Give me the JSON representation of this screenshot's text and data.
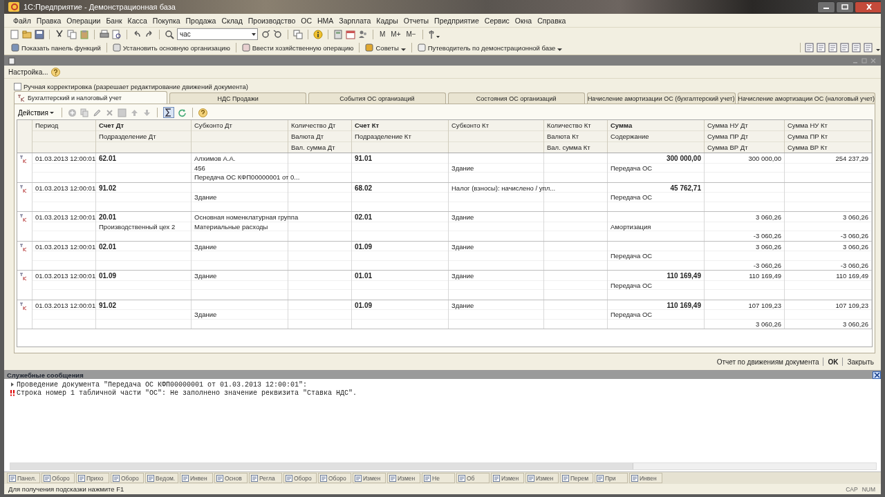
{
  "window": {
    "title": "1С:Предприятие - Демонстрационная база"
  },
  "menu": [
    "Файл",
    "Правка",
    "Операции",
    "Банк",
    "Касса",
    "Покупка",
    "Продажа",
    "Склад",
    "Производство",
    "ОС",
    "НМА",
    "Зарплата",
    "Кадры",
    "Отчеты",
    "Предприятие",
    "Сервис",
    "Окна",
    "Справка"
  ],
  "toolbar": {
    "search": {
      "value": "час"
    },
    "memory_buttons": [
      "M",
      "M+",
      "M−"
    ]
  },
  "toolbar_2": [
    "Показать панель функций",
    "Установить основную организацию",
    "Ввести хозяйственную операцию",
    "Советы",
    "Путеводитель по демонстрационной базе"
  ],
  "document": {
    "settings_link": "Настройка...",
    "manual_edit": {
      "label": "Ручная корректировка (разрешает редактирование движений документа)",
      "checked": false
    },
    "tabs": [
      {
        "label": "Бухгалтерский и налоговый учет",
        "selected": true
      },
      {
        "label": "НДС Продажи",
        "selected": false
      },
      {
        "label": "События ОС организаций",
        "selected": false
      },
      {
        "label": "Состояния ОС организаций",
        "selected": false
      },
      {
        "label": "Начисление амортизации ОС (бухгалтерский учет)",
        "selected": false
      },
      {
        "label": "Начисление амортизации ОС (налоговый учет)",
        "selected": false
      }
    ],
    "actions_button": "Действия",
    "table": {
      "columns": [
        {
          "kind": "text",
          "header": [
            "Период"
          ]
        },
        {
          "kind": "account",
          "header": [
            "Счет Дт",
            "Подразделение Дт"
          ]
        },
        {
          "kind": "text",
          "header": [
            "Субконто Дт"
          ]
        },
        {
          "kind": "text",
          "header": [
            "Количество Дт",
            "Валюта Дт",
            "Вал. сумма Дт"
          ]
        },
        {
          "kind": "account",
          "header": [
            "Счет Кт",
            "Подразделение Кт"
          ]
        },
        {
          "kind": "text",
          "header": [
            "Субконто Кт"
          ]
        },
        {
          "kind": "text",
          "header": [
            "Количество Кт",
            "Валюта Кт",
            "Вал. сумма Кт"
          ]
        },
        {
          "kind": "sum",
          "header": [
            "Сумма",
            "Содержание"
          ]
        },
        {
          "kind": "amount",
          "header": [
            "Сумма НУ Дт",
            "Сумма ПР Дт",
            "Сумма ВР Дт"
          ]
        },
        {
          "kind": "amount",
          "header": [
            "Сумма НУ Кт",
            "Сумма ПР Кт",
            "Сумма ВР Кт"
          ]
        }
      ],
      "rows": [
        {
          "cells": [
            {
              "line_1": "01.03.2013 12:00:01"
            },
            {
              "line_1": "62.01"
            },
            {
              "line_1": "Алхимов А.А.",
              "line_2": "456",
              "line_3": "Передача ОС КФП00000001 от 0..."
            },
            {},
            {
              "line_1": "91.01"
            },
            {
              "line_2": "Здание"
            },
            {},
            {
              "line_1": "300 000,00",
              "line_2": "Передача ОС"
            },
            {
              "line_1": "300 000,00"
            },
            {
              "line_1": "254 237,29"
            }
          ]
        },
        {
          "cells": [
            {
              "line_1": "01.03.2013 12:00:01"
            },
            {
              "line_1": "91.02"
            },
            {
              "line_2": "Здание"
            },
            {},
            {
              "line_1": "68.02"
            },
            {
              "line_1": "Налог (взносы): начислено / упл..."
            },
            {},
            {
              "line_1": "45 762,71",
              "line_2": "Передача ОС"
            },
            {},
            {}
          ]
        },
        {
          "cells": [
            {
              "line_1": "01.03.2013 12:00:01"
            },
            {
              "line_1": "20.01",
              "line_2": "Производственный цех 2"
            },
            {
              "line_1": "Основная номенклатурная группа",
              "line_2": "Материальные расходы"
            },
            {},
            {
              "line_1": "02.01"
            },
            {
              "line_1": "Здание"
            },
            {},
            {
              "line_2": "Амортизация"
            },
            {
              "line_1": "3 060,26",
              "line_3": "-3 060,26"
            },
            {
              "line_1": "3 060,26",
              "line_3": "-3 060,26"
            }
          ]
        },
        {
          "cells": [
            {
              "line_1": "01.03.2013 12:00:01"
            },
            {
              "line_1": "02.01"
            },
            {
              "line_1": "Здание"
            },
            {},
            {
              "line_1": "01.09"
            },
            {
              "line_1": "Здание"
            },
            {},
            {
              "line_2": "Передача ОС"
            },
            {
              "line_1": "3 060,26",
              "line_3": "-3 060,26"
            },
            {
              "line_1": "3 060,26",
              "line_3": "-3 060,26"
            }
          ]
        },
        {
          "cells": [
            {
              "line_1": "01.03.2013 12:00:01"
            },
            {
              "line_1": "01.09"
            },
            {
              "line_1": "Здание"
            },
            {},
            {
              "line_1": "01.01"
            },
            {
              "line_1": "Здание"
            },
            {},
            {
              "line_1": "110 169,49",
              "line_2": "Передача ОС"
            },
            {
              "line_1": "110 169,49"
            },
            {
              "line_1": "110 169,49"
            }
          ]
        },
        {
          "cells": [
            {
              "line_1": "01.03.2013 12:00:01"
            },
            {
              "line_1": "91.02"
            },
            {
              "line_2": "Здание"
            },
            {},
            {
              "line_1": "01.09"
            },
            {
              "line_1": "Здание"
            },
            {},
            {
              "line_1": "110 169,49",
              "line_2": "Передача ОС"
            },
            {
              "line_1": "107 109,23",
              "line_3": "3 060,26"
            },
            {
              "line_1": "107 109,23",
              "line_3": "3 060,26"
            }
          ]
        }
      ]
    },
    "footer_buttons": [
      {
        "label": "Отчет по движениям документа",
        "kind": "link"
      },
      {
        "label": "OK",
        "kind": "default"
      },
      {
        "label": "Закрыть",
        "kind": "link"
      }
    ]
  },
  "messages": {
    "title": "Служебные сообщения",
    "lines": [
      {
        "kind": "info",
        "text": "Проведение документа \"Передача ОС КФП00000001 от 01.03.2013 12:00:01\":"
      },
      {
        "kind": "error",
        "text": "Строка номер 1 табличной части \"ОС\": Не заполнено значение реквизита \"Ставка НДС\"."
      }
    ]
  },
  "taskbar": [
    "Панел.",
    "Оборо",
    "Прихо",
    "Оборо",
    "Ведом.",
    "Инвен",
    "Основ",
    "Регла",
    "Оборо",
    "Оборо",
    "Измен",
    "Измен",
    "Не",
    "Об",
    "Измен",
    "Измен",
    "Перем",
    "При",
    "Инвен"
  ],
  "status_bar": {
    "hint": "Для получения подсказки нажмите F1",
    "indicators": [
      "CAP",
      "NUM"
    ]
  }
}
